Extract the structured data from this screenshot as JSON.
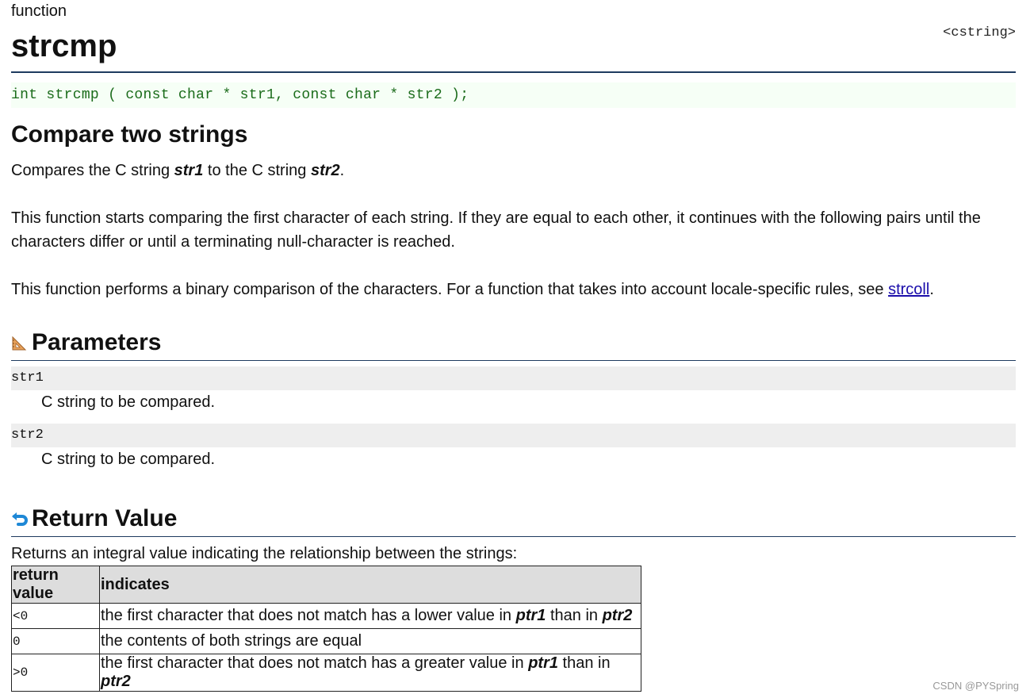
{
  "header": {
    "kind": "function",
    "title": "strcmp",
    "file": "<cstring>"
  },
  "prototype": "int strcmp ( const char * str1, const char * str2 );",
  "summary": "Compare two strings",
  "description": {
    "p1_a": "Compares the C string ",
    "p1_b": "str1",
    "p1_c": " to the C string ",
    "p1_d": "str2",
    "p1_e": ".",
    "p2": "This function starts comparing the first character of each string. If they are equal to each other, it continues with the following pairs until the characters differ or until a terminating null-character is reached.",
    "p3_a": "This function performs a binary comparison of the characters. For a function that takes into account locale-specific rules, see ",
    "p3_link": "strcoll",
    "p3_b": "."
  },
  "parameters": {
    "heading": "Parameters",
    "items": [
      {
        "name": "str1",
        "desc": "C string to be compared."
      },
      {
        "name": "str2",
        "desc": "C string to be compared."
      }
    ]
  },
  "return_value": {
    "heading": "Return Value",
    "intro": "Returns an integral value indicating the relationship between the strings:",
    "headers": [
      "return value",
      "indicates"
    ],
    "rows": [
      {
        "value": "<0",
        "a": "the first character that does not match has a lower value in ",
        "b": "ptr1",
        "c": " than in ",
        "d": "ptr2"
      },
      {
        "value": "0",
        "a": "the contents of both strings are equal",
        "b": "",
        "c": "",
        "d": ""
      },
      {
        "value": ">0",
        "a": "the first character that does not match has a greater value in ",
        "b": "ptr1",
        "c": " than in ",
        "d": "ptr2"
      }
    ]
  },
  "watermark": "CSDN @PYSpring",
  "colors": {
    "rule": "#1e3a5f",
    "prototype_text": "#1a6b1a",
    "link": "#1a0dab"
  }
}
